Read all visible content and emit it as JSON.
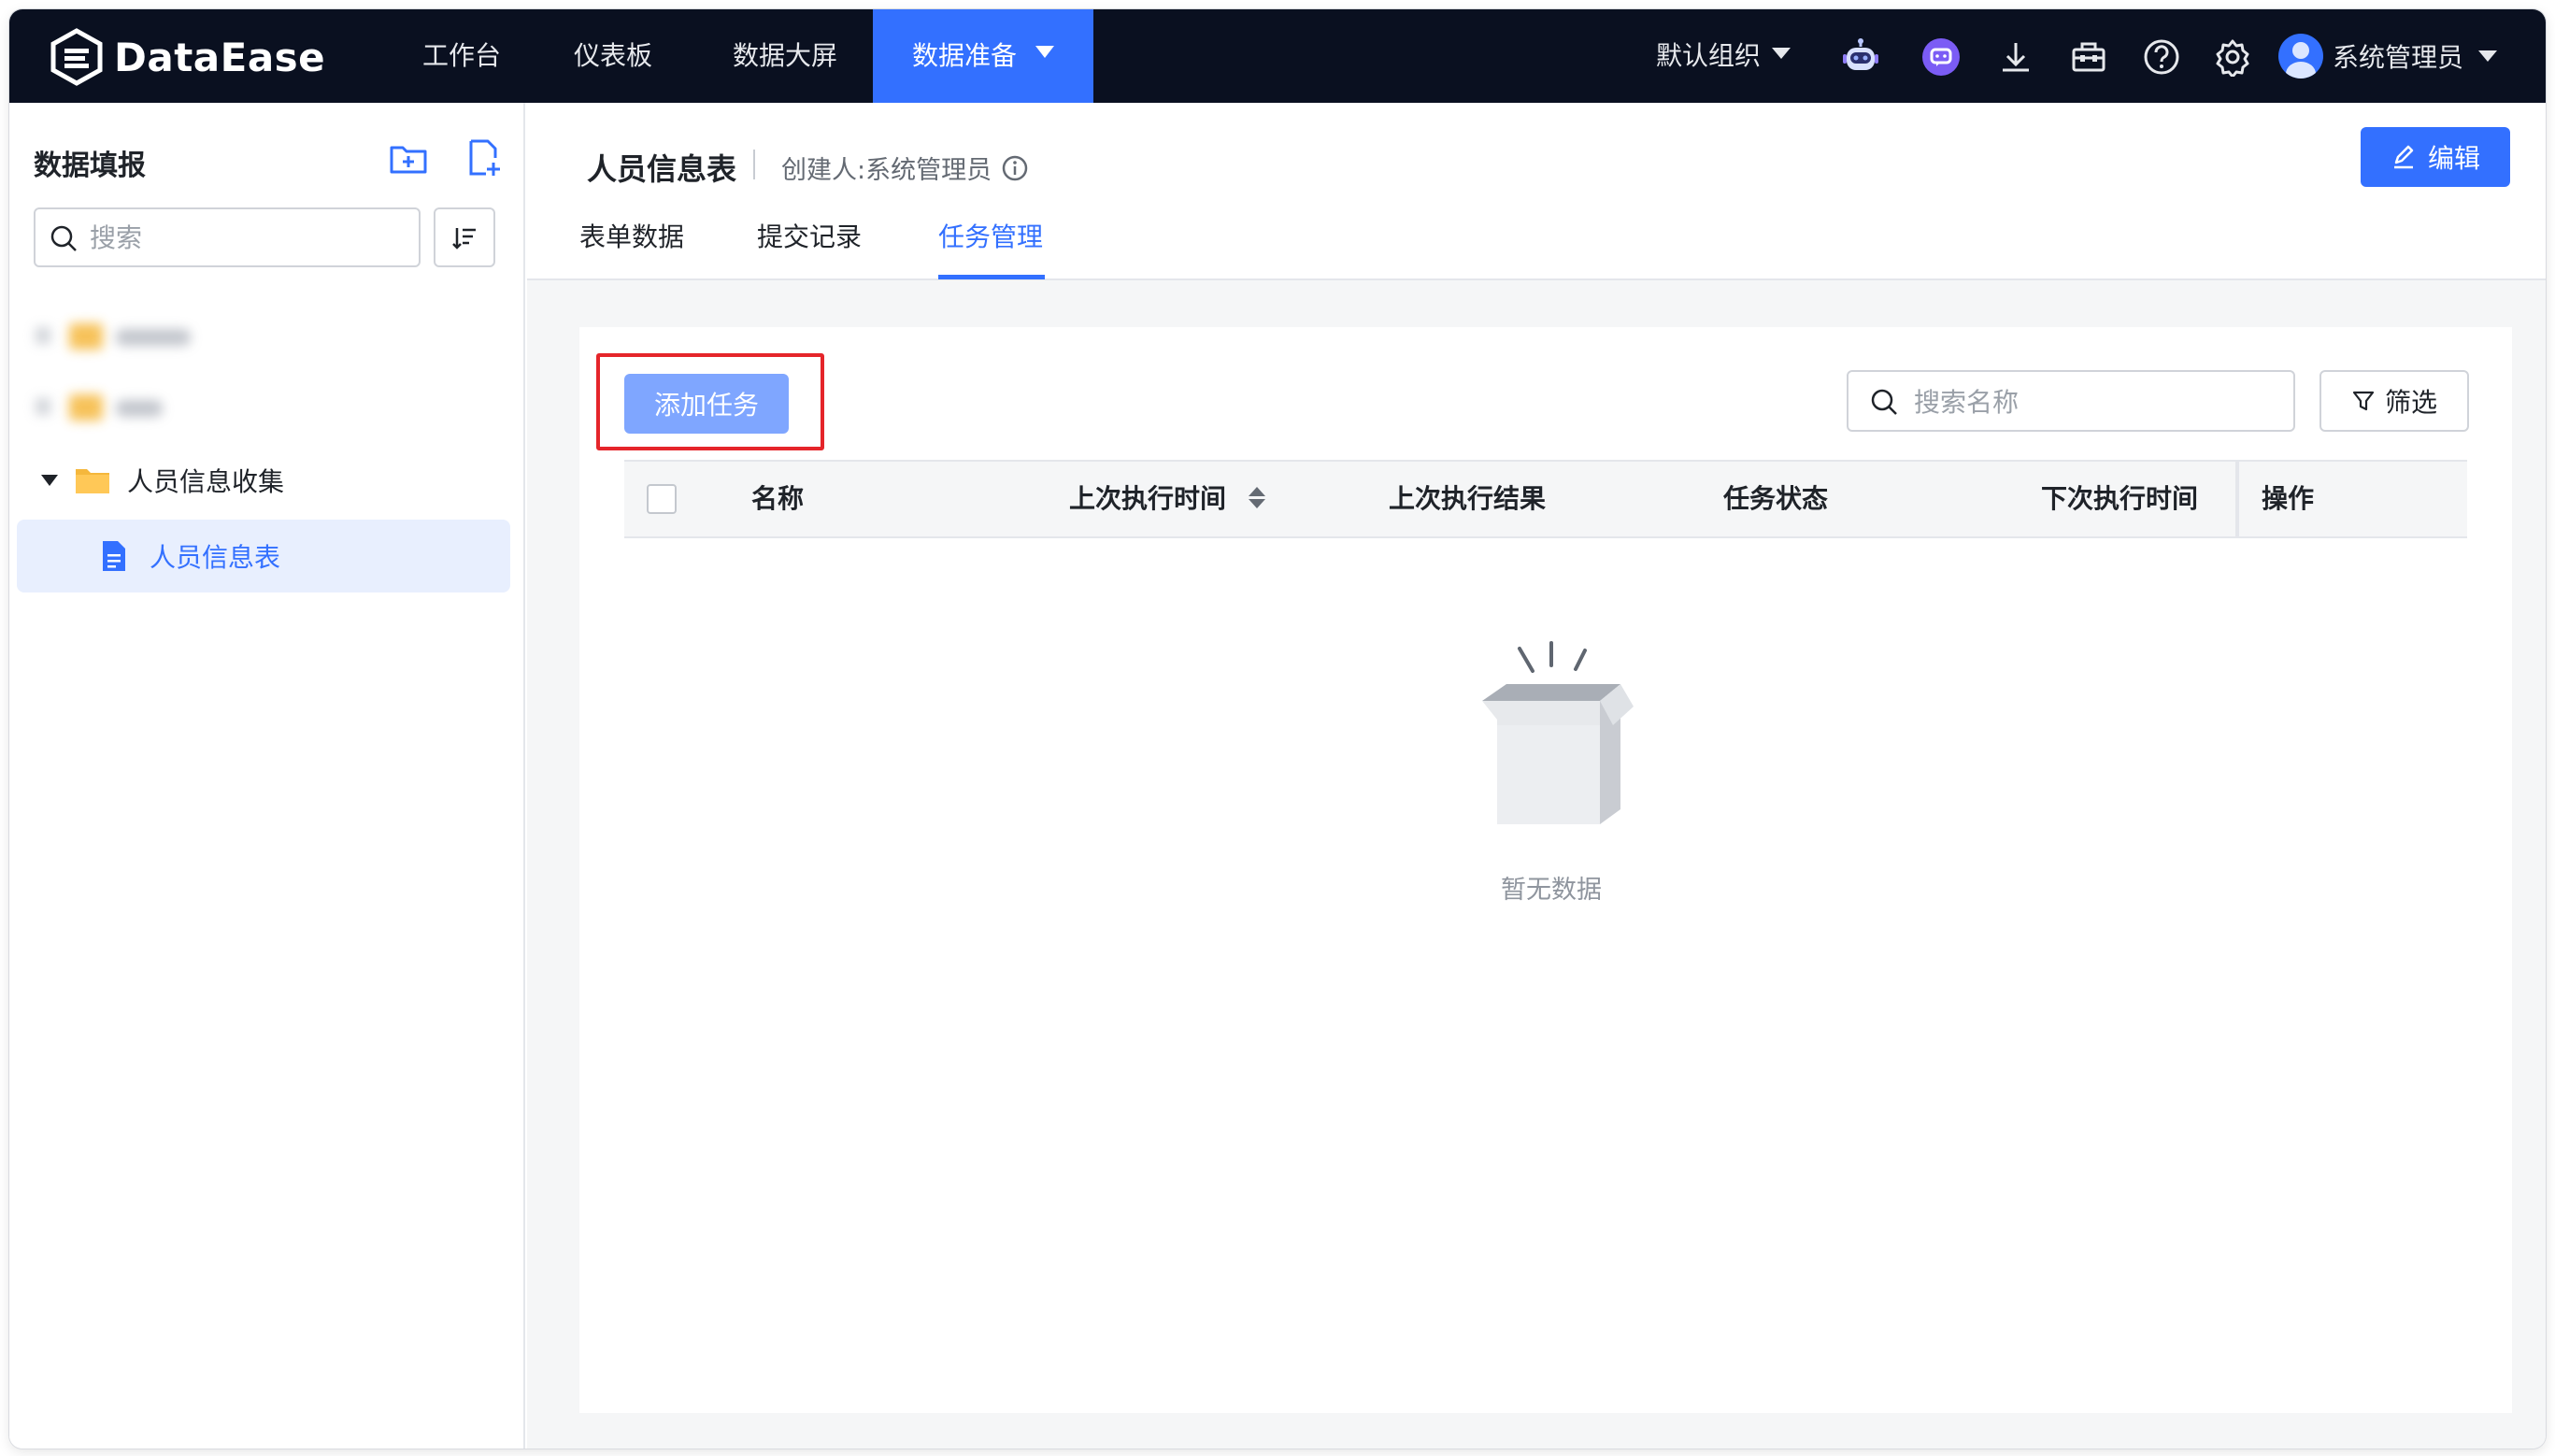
{
  "app": {
    "brand": "DataEase",
    "nav": [
      {
        "label": "工作台"
      },
      {
        "label": "仪表板"
      },
      {
        "label": "数据大屏"
      },
      {
        "label": "数据准备",
        "active": true
      }
    ],
    "org_label": "默认组织",
    "user_name": "系统管理员",
    "toolbar_icons": [
      "robot-icon",
      "chat-bot-icon",
      "download-icon",
      "toolbox-icon",
      "help-icon",
      "gear-icon"
    ],
    "accent_color": "#3370ff",
    "topbar_color": "#0a1020"
  },
  "sidebar": {
    "title": "数据填报",
    "search_placeholder": "搜索",
    "tree": {
      "folder_label": "人员信息收集",
      "file_label": "人员信息表"
    }
  },
  "main": {
    "title": "人员信息表",
    "creator": "创建人:系统管理员",
    "edit_label": "编辑",
    "tabs": [
      {
        "label": "表单数据"
      },
      {
        "label": "提交记录"
      },
      {
        "label": "任务管理",
        "active": true
      }
    ],
    "add_task_label": "添加任务",
    "search_placeholder": "搜索名称",
    "filter_label": "筛选",
    "columns": [
      "名称",
      "上次执行时间",
      "上次执行结果",
      "任务状态",
      "下次执行时间",
      "操作"
    ],
    "empty_text": "暂无数据",
    "highlight_color": "#e5252a"
  }
}
